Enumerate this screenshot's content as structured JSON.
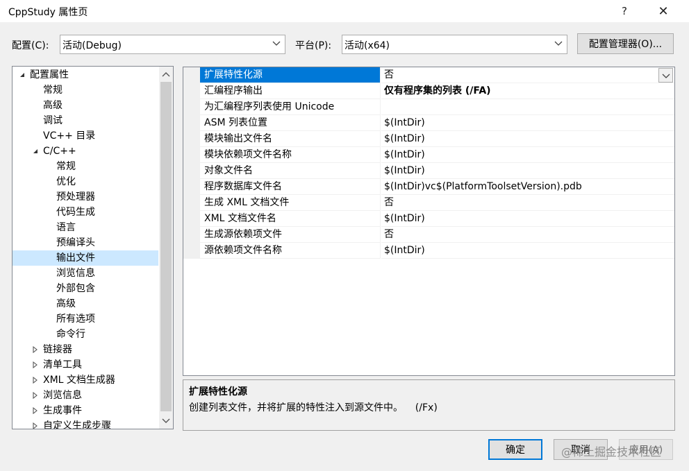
{
  "window": {
    "title": "CppStudy 属性页",
    "help_label": "?",
    "close_label": "✕"
  },
  "config": {
    "label": "配置(C):",
    "value": "活动(Debug)",
    "platform_label": "平台(P):",
    "platform_value": "活动(x64)",
    "manager_button": "配置管理器(O)..."
  },
  "tree": {
    "items": [
      {
        "label": "配置属性",
        "expander": "expanded"
      },
      {
        "label": "常规"
      },
      {
        "label": "高级"
      },
      {
        "label": "调试"
      },
      {
        "label": "VC++ 目录"
      },
      {
        "label": "C/C++",
        "expander": "expanded"
      },
      {
        "label": "常规"
      },
      {
        "label": "优化"
      },
      {
        "label": "预处理器"
      },
      {
        "label": "代码生成"
      },
      {
        "label": "语言"
      },
      {
        "label": "预编译头"
      },
      {
        "label": "输出文件",
        "selected": true
      },
      {
        "label": "浏览信息"
      },
      {
        "label": "外部包含"
      },
      {
        "label": "高级"
      },
      {
        "label": "所有选项"
      },
      {
        "label": "命令行"
      },
      {
        "label": "链接器",
        "expander": "collapsed"
      },
      {
        "label": "清单工具",
        "expander": "collapsed"
      },
      {
        "label": "XML 文档生成器",
        "expander": "collapsed"
      },
      {
        "label": "浏览信息",
        "expander": "collapsed"
      },
      {
        "label": "生成事件",
        "expander": "collapsed"
      },
      {
        "label": "自定义生成步骤",
        "expander": "collapsed"
      }
    ]
  },
  "properties": {
    "rows": [
      {
        "name": "扩展特性化源",
        "value": "否",
        "selected": true
      },
      {
        "name": "汇编程序输出",
        "value": "仅有程序集的列表 (/FA)",
        "bold": true
      },
      {
        "name": "为汇编程序列表使用 Unicode",
        "value": ""
      },
      {
        "name": "ASM 列表位置",
        "value": "$(IntDir)"
      },
      {
        "name": "模块输出文件名",
        "value": "$(IntDir)"
      },
      {
        "name": "模块依赖项文件名称",
        "value": "$(IntDir)"
      },
      {
        "name": "对象文件名",
        "value": "$(IntDir)"
      },
      {
        "name": "程序数据库文件名",
        "value": "$(IntDir)vc$(PlatformToolsetVersion).pdb"
      },
      {
        "name": "生成 XML 文档文件",
        "value": "否"
      },
      {
        "name": "XML 文档文件名",
        "value": "$(IntDir)"
      },
      {
        "name": "生成源依赖项文件",
        "value": "否"
      },
      {
        "name": "源依赖项文件名称",
        "value": "$(IntDir)"
      }
    ]
  },
  "description": {
    "title": "扩展特性化源",
    "text": "创建列表文件，并将扩展的特性注入到源文件中。    (/Fx)"
  },
  "buttons": {
    "ok": "确定",
    "cancel": "取消",
    "apply": "应用(A)"
  },
  "watermark": "@稀土掘金技术社区",
  "colors": {
    "selection": "#0078d7",
    "tree_selection": "#cce8ff",
    "dialog_bg": "#f0f0f0"
  }
}
